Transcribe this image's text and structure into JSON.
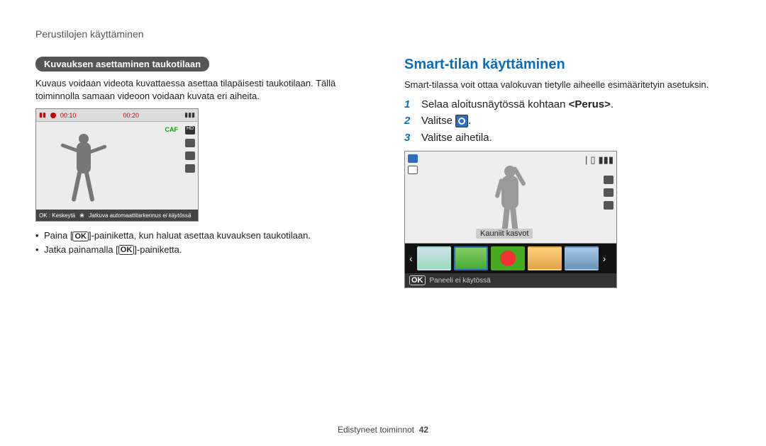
{
  "page_header": "Perustilojen käyttäminen",
  "left": {
    "pill": "Kuvauksen asettaminen taukotilaan",
    "body": "Kuvaus voidaan videota kuvattaessa asettaa tilapäisesti taukotilaan. Tällä toiminnolla samaan videoon voidaan kuvata eri aiheita.",
    "rec_time1": "00:10",
    "rec_time2": "00:20",
    "caf": "CAF",
    "hd": "HD",
    "botbar_ok": "OK : Keskeytä",
    "botbar_rest": "Jatkuva automaattitarkennus ei käytössä",
    "bullet1_pre": "Paina [",
    "bullet1_post": "]-painiketta, kun haluat asettaa kuvauksen taukotilaan.",
    "bullet2_pre": "Jatka painamalla [",
    "bullet2_post": "]-painiketta.",
    "ok_label": "OK"
  },
  "right": {
    "heading": "Smart-tilan käyttäminen",
    "intro": "Smart-tilassa voit ottaa valokuvan tietylle aiheelle esimääritetyin asetuksin.",
    "step1_pre": "Selaa aloitusnäytössä kohtaan ",
    "step1_bold": "<Perus>",
    "step1_post": ".",
    "step2_pre": "Valitse ",
    "step2_post": ".",
    "step3": "Valitse aihetila.",
    "cam_label": "Kauniit kasvot",
    "cam_bot_ok": "OK",
    "cam_bot_text": "Paneeli ei käytössä"
  },
  "footer": {
    "section": "Edistyneet toiminnot",
    "page": "42"
  }
}
